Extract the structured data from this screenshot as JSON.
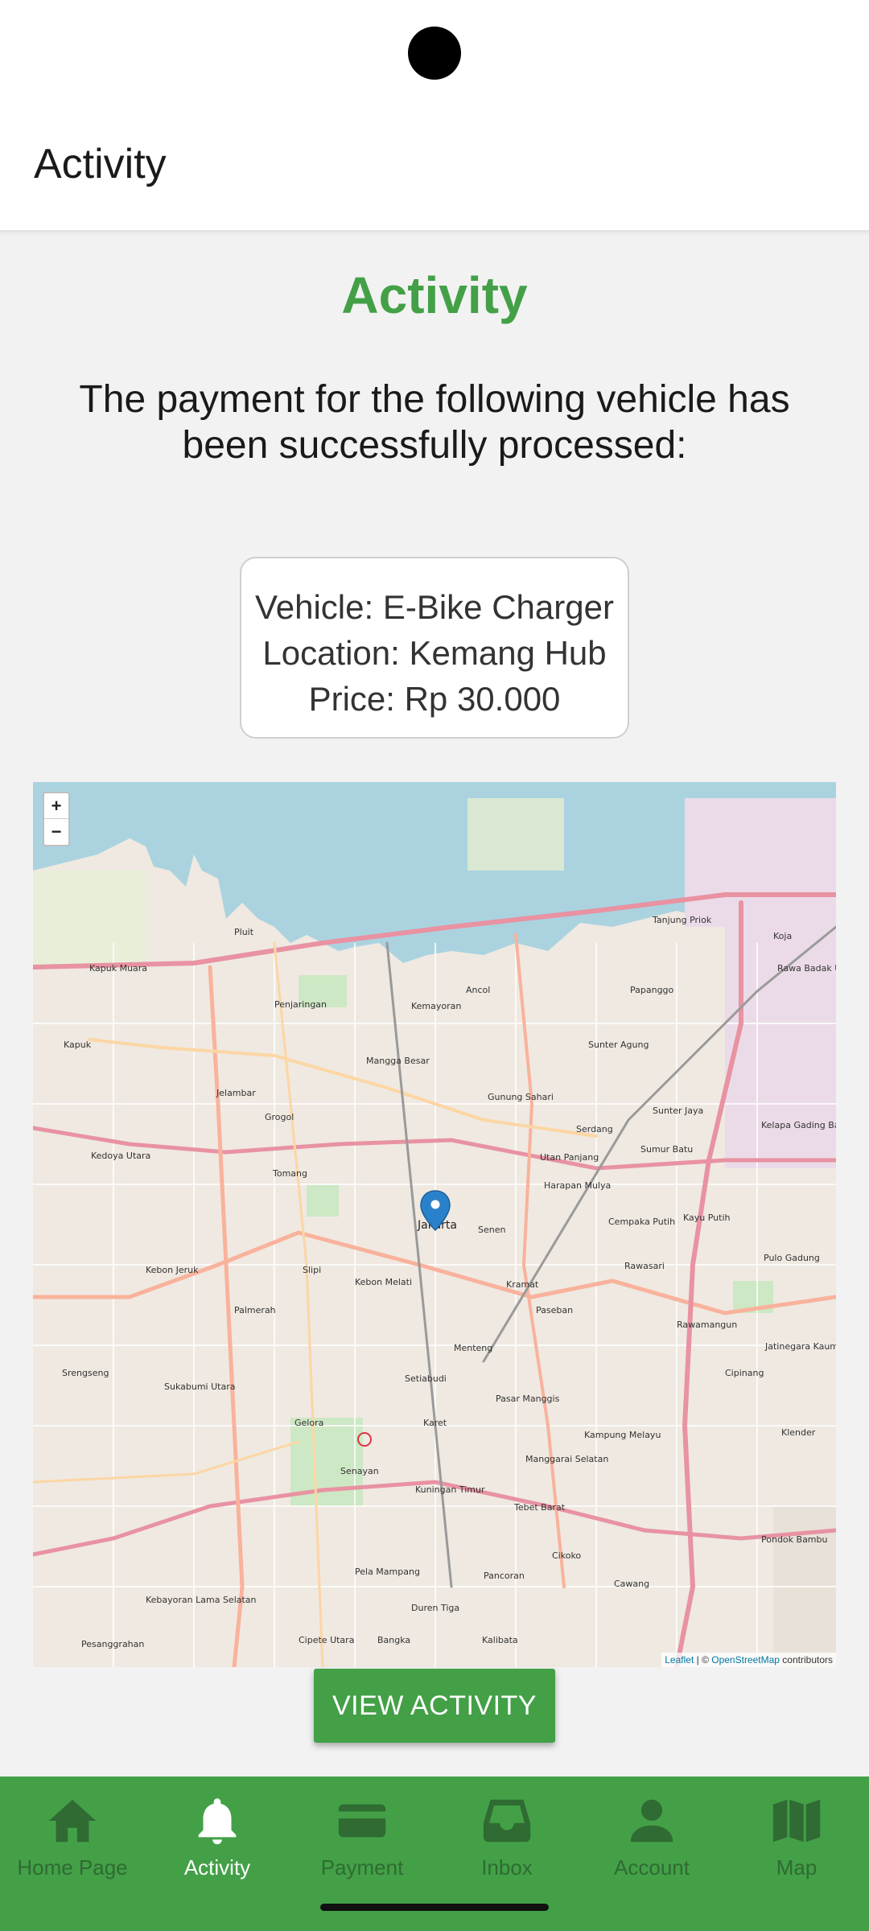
{
  "header": {
    "title": "Activity"
  },
  "content": {
    "title": "Activity",
    "message": "The payment for the following vehicle has been successfully processed:",
    "vehicle_line": "Vehicle: E-Bike Charger",
    "location_line": "Location: Kemang Hub",
    "price_line": "Price: Rp 30.000"
  },
  "map": {
    "zoom_in": "+",
    "zoom_out": "−",
    "attribution_leaflet": "Leaflet",
    "attribution_sep": " | © ",
    "attribution_osm": "OpenStreetMap",
    "attribution_tail": " contributors",
    "labels": {
      "jakarta": "Jakarta",
      "pluit": "Pluit",
      "ancol": "Ancol",
      "penjaringan": "Penjaringan",
      "kapuk_muara": "Kapuk Muara",
      "kapuk": "Kapuk",
      "tanjung_priok": "Tanjung Priok",
      "sunter_agung": "Sunter Agung",
      "sunter_jaya": "Sunter Jaya",
      "kelapa_gading_barat": "Kelapa Gading Barat",
      "cempaka_putih": "Cempaka Putih",
      "rawasari": "Rawasari",
      "menteng": "Menteng",
      "senen": "Senen",
      "kebon_melati": "Kebon Melati",
      "palmerah": "Palmerah",
      "slipi": "Slipi",
      "tomang": "Tomang",
      "grogol": "Grogol",
      "kedoya_utara": "Kedoya Utara",
      "kebon_jeruk": "Kebon Jeruk",
      "senayan": "Senayan",
      "gelora": "Gelora",
      "karet": "Karet",
      "setiabudi": "Setiabudi",
      "kuningan_timur": "Kuningan Timur",
      "pancoran": "Pancoran",
      "kalibata": "Kalibata",
      "cikoko": "Cikoko",
      "cawang": "Cawang",
      "tebet_barat": "Tebet Barat",
      "kampung_melayu": "Kampung Melayu",
      "jatinegara": "Jatinegara Kaum",
      "pulo_gadung": "Pulo Gadung",
      "rawamangun": "Rawamangun",
      "cipinang": "Cipinang",
      "kelender": "Klender",
      "kebayoran": "Kebayoran Lama Selatan",
      "pesanggrahan": "Pesanggrahan",
      "pela_mampang": "Pela Mampang",
      "duren_tiga": "Duren Tiga",
      "bangka": "Bangka",
      "cipete_utara": "Cipete Utara",
      "pondok_bambu": "Pondok Bambu",
      "kayu_putih": "Kayu Putih",
      "kemayoran": "Kemayoran",
      "gunung_sahari": "Gunung Sahari",
      "mangga_besar": "Mangga Besar",
      "jelambar": "Jelambar",
      "sukabumi_utara": "Sukabumi Utara",
      "srengseng": "Srengseng",
      "kramat": "Kramat",
      "paseban": "Paseban",
      "pasar_manggis": "Pasar Manggis",
      "manggarai": "Manggarai Selatan",
      "papanggo": "Papanggo",
      "serdang": "Serdang",
      "sumur_batu": "Sumur Batu",
      "utan_panjang": "Utan Panjang",
      "harapan_mulya": "Harapan Mulya",
      "rawa_badak": "Rawa Badak Utara",
      "koja": "Koja"
    }
  },
  "actions": {
    "view_activity": "VIEW ACTIVITY"
  },
  "nav": {
    "items": [
      {
        "label": "Home Page",
        "icon": "home-icon",
        "active": false
      },
      {
        "label": "Activity",
        "icon": "bell-icon",
        "active": true
      },
      {
        "label": "Payment",
        "icon": "credit-card-icon",
        "active": false
      },
      {
        "label": "Inbox",
        "icon": "inbox-icon",
        "active": false
      },
      {
        "label": "Account",
        "icon": "person-icon",
        "active": false
      },
      {
        "label": "Map",
        "icon": "map-icon",
        "active": false
      }
    ]
  },
  "colors": {
    "accent": "#43a047",
    "nav_inactive": "#2f6b32",
    "nav_active": "#ffffff",
    "water": "#aad3df",
    "marker": "#2a81cb"
  }
}
